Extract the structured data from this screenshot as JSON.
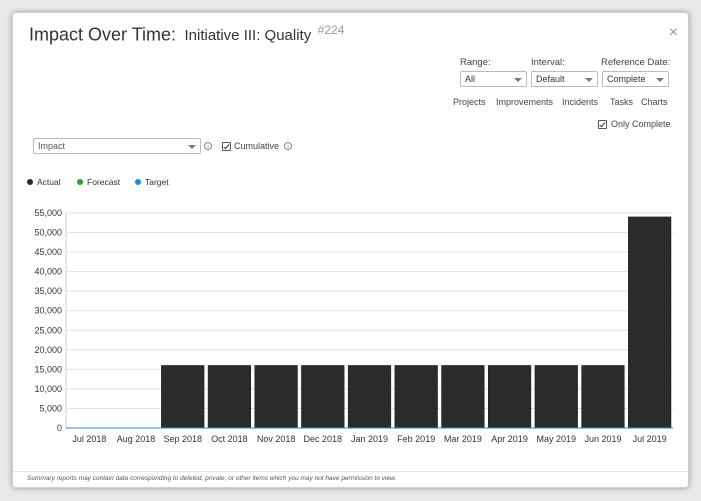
{
  "modal": {
    "title": "Impact Over Time:",
    "subtitle": "Initiative III: Quality",
    "number": "#224",
    "close_glyph": "×"
  },
  "controls": {
    "range_label": "Range:",
    "range_value": "All",
    "interval_label": "Interval:",
    "interval_value": "Default",
    "reference_label": "Reference Date:",
    "reference_value": "Complete",
    "links": [
      "Projects",
      "Improvements",
      "Incidents",
      "Tasks",
      "Charts"
    ],
    "only_complete": "Only Complete",
    "metric_value": "Impact",
    "cumulative": "Cumulative",
    "info_glyph": "i"
  },
  "legend": [
    {
      "label": "Actual",
      "color": "#2b2b2b"
    },
    {
      "label": "Forecast",
      "color": "#2ca02c"
    },
    {
      "label": "Target",
      "color": "#1f8dd6"
    }
  ],
  "chart_data": {
    "type": "bar",
    "categories": [
      "Jul 2018",
      "Aug 2018",
      "Sep 2018",
      "Oct 2018",
      "Nov 2018",
      "Dec 2018",
      "Jan 2019",
      "Feb 2019",
      "Mar 2019",
      "Apr 2019",
      "May 2019",
      "Jun 2019",
      "Jul 2019"
    ],
    "series": [
      {
        "name": "Actual",
        "values": [
          0,
          0,
          16000,
          16000,
          16000,
          16000,
          16000,
          16000,
          16000,
          16000,
          16000,
          16000,
          54000
        ]
      }
    ],
    "yticks": [
      0,
      5000,
      10000,
      15000,
      20000,
      25000,
      30000,
      35000,
      40000,
      45000,
      50000,
      55000
    ],
    "ytick_labels": [
      "0",
      "5,000",
      "10,000",
      "15,000",
      "20,000",
      "25,000",
      "30,000",
      "35,000",
      "40,000",
      "45,000",
      "50,000",
      "55,000"
    ],
    "ylim": [
      0,
      55000
    ],
    "grid": true,
    "bar_color": "#2b2b2b",
    "target_color": "#1f8dd6"
  },
  "footer": {
    "note": "Summary reports may contain data corresponding to deleted, private, or other items which you may not have permission to view."
  }
}
